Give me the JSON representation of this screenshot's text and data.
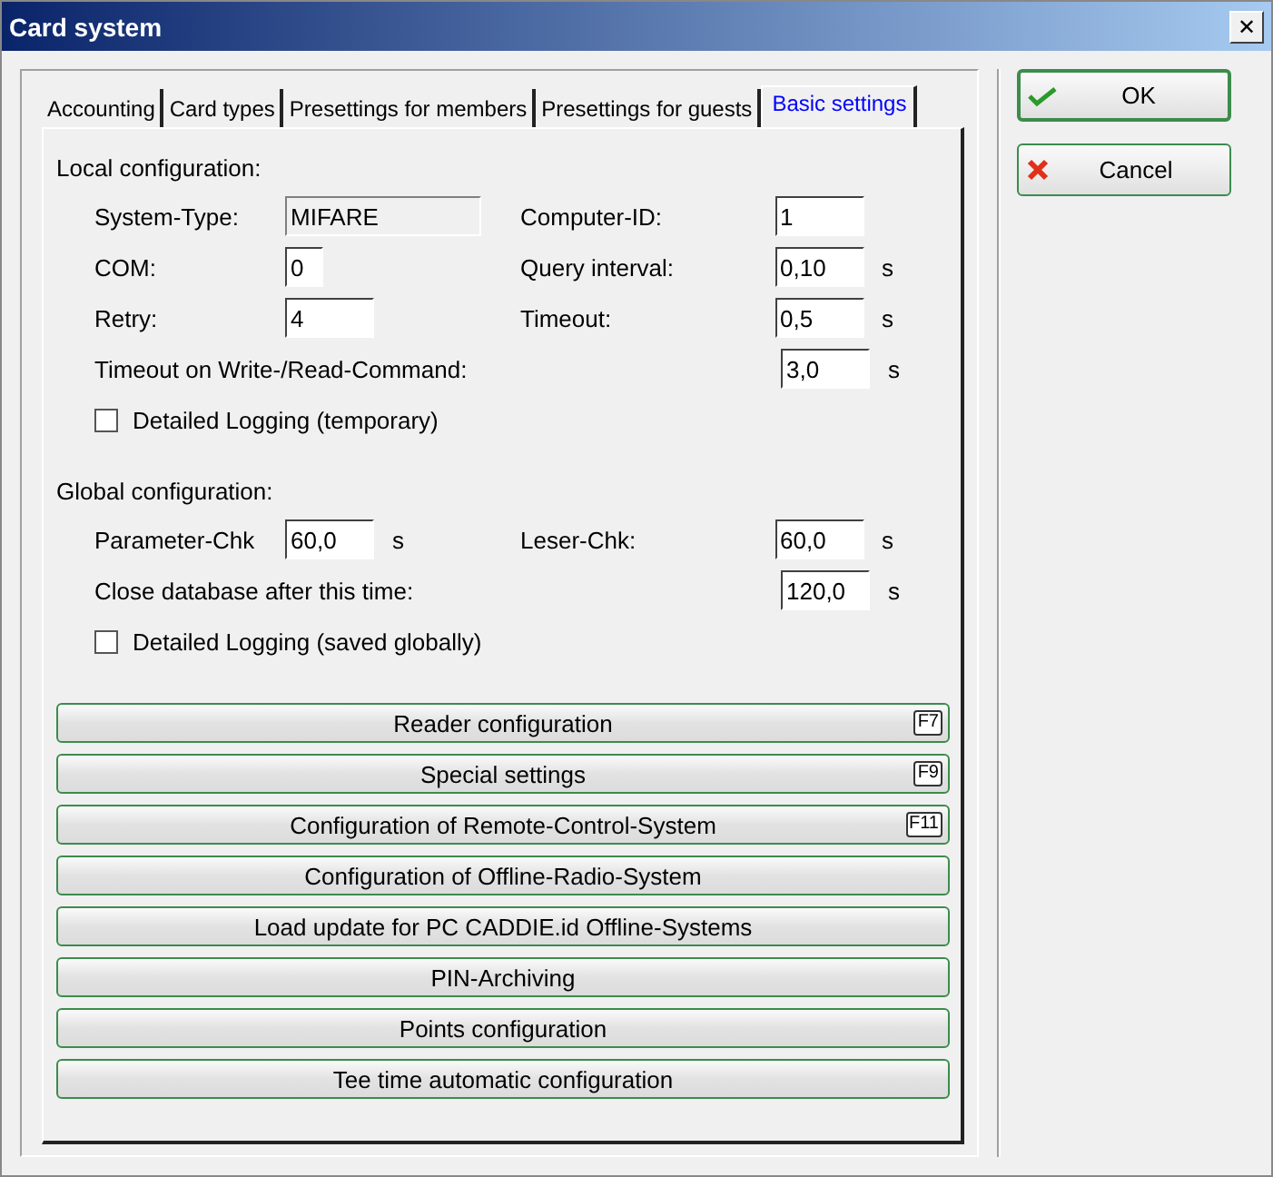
{
  "window": {
    "title": "Card system",
    "close": "✕"
  },
  "tabs": [
    {
      "label": "Accounting",
      "selected": false
    },
    {
      "label": "Card types",
      "selected": false
    },
    {
      "label": "Presettings for members",
      "selected": false
    },
    {
      "label": "Presettings for guests",
      "selected": false
    },
    {
      "label": "Basic settings",
      "selected": true
    }
  ],
  "sections": [
    {
      "title": "Local configuration:",
      "rows": [
        {
          "kind": "pair",
          "left": {
            "label": "System-Type:",
            "value": "MIFARE",
            "readonly": true,
            "kind": "wide"
          },
          "right": {
            "label": "Computer-ID:",
            "value": "1"
          }
        },
        {
          "kind": "pair",
          "left": {
            "label": "COM:",
            "value": "0",
            "kind": "tiny"
          },
          "right": {
            "label": "Query interval:",
            "value": "0,10",
            "unit": "s"
          }
        },
        {
          "kind": "pair",
          "left": {
            "label": "Retry:",
            "value": "4",
            "kind": "normal"
          },
          "right": {
            "label": "Timeout:",
            "value": "0,5",
            "unit": "s"
          }
        },
        {
          "kind": "long",
          "label": "Timeout on Write-/Read-Command:",
          "value": "3,0",
          "unit": "s"
        },
        {
          "kind": "checkbox",
          "label": "Detailed Logging (temporary)",
          "checked": false
        }
      ]
    },
    {
      "title": "Global configuration:",
      "rows": [
        {
          "kind": "pair",
          "left": {
            "label": "Parameter-Chk",
            "value": "60,0",
            "unit": "s",
            "kind": "normal"
          },
          "right": {
            "label": "Leser-Chk:",
            "value": "60,0",
            "unit": "s"
          }
        },
        {
          "kind": "long",
          "label": "Close database after this time:",
          "value": "120,0",
          "unit": "s"
        },
        {
          "kind": "checkbox",
          "label": "Detailed Logging (saved globally)",
          "checked": false
        }
      ]
    }
  ],
  "actions": [
    {
      "label": "Reader configuration",
      "key": "F7"
    },
    {
      "label": "Special settings",
      "key": "F9"
    },
    {
      "label": "Configuration of Remote-Control-System",
      "key": "F11"
    },
    {
      "label": "Configuration of Offline-Radio-System"
    },
    {
      "label": "Load update for PC CADDIE.id Offline-Systems"
    },
    {
      "label": "PIN-Archiving"
    },
    {
      "label": "Points configuration"
    },
    {
      "label": "Tee time automatic configuration"
    }
  ],
  "buttons": [
    {
      "label": "OK",
      "kind": "ok"
    },
    {
      "label": "Cancel",
      "kind": "cancel"
    }
  ]
}
